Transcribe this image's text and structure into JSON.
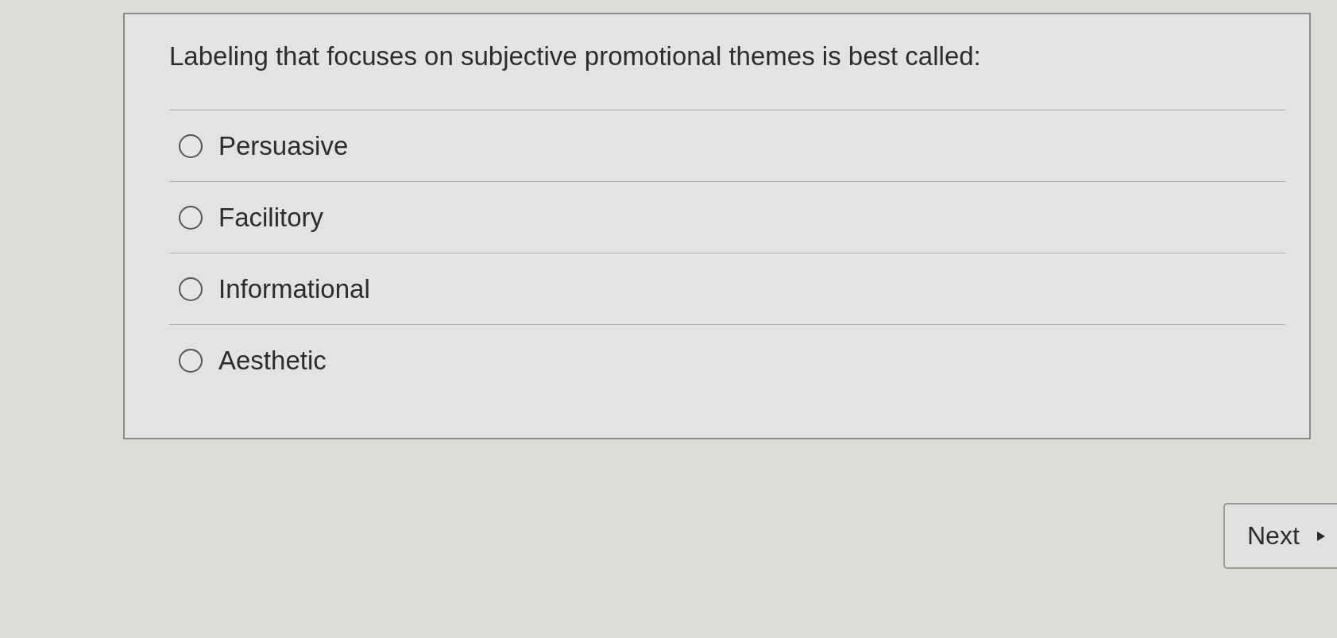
{
  "question": {
    "text": "Labeling that focuses on subjective promotional themes is best called:"
  },
  "options": [
    {
      "label": "Persuasive",
      "selected": false
    },
    {
      "label": "Facilitory",
      "selected": false
    },
    {
      "label": "Informational",
      "selected": false
    },
    {
      "label": "Aesthetic",
      "selected": false
    }
  ],
  "buttons": {
    "next": {
      "label": "Next"
    }
  }
}
